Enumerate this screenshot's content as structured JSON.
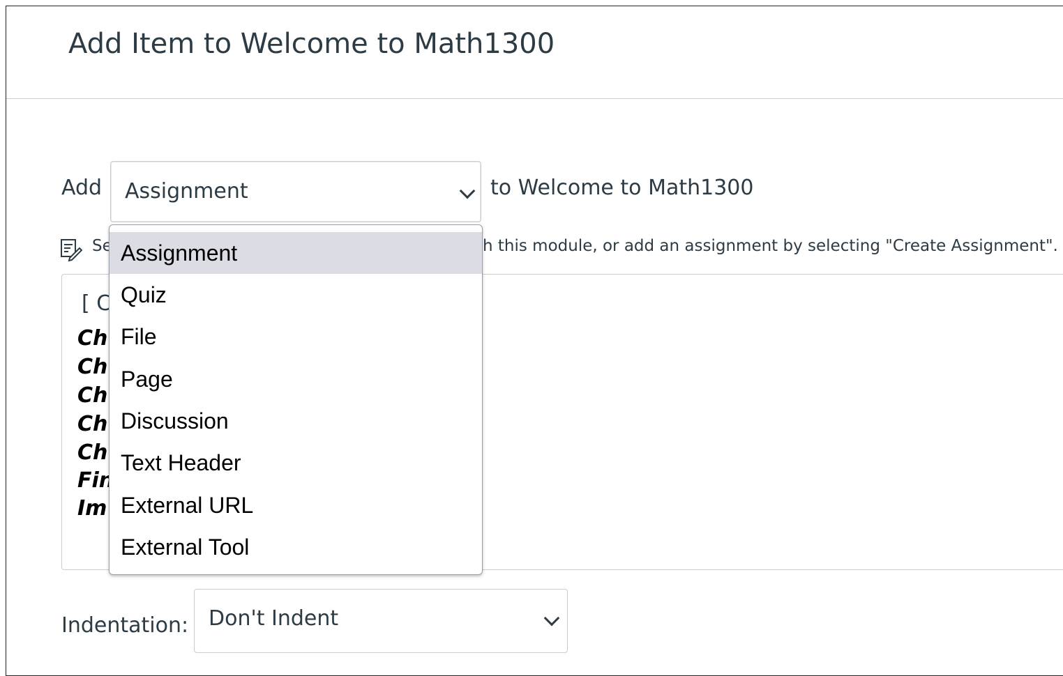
{
  "dialog": {
    "title": "Add Item to Welcome to Math1300"
  },
  "add_row": {
    "prefix": "Add",
    "selected_type": "Assignment",
    "suffix": "to Welcome to Math1300"
  },
  "hint": {
    "icon": "edit-assignment-icon",
    "text_start": "Se",
    "text_end": "h this module, or add an assignment by selecting \"Create Assignment\"."
  },
  "list_box": {
    "placeholder_visible": "[ C",
    "options_visible": [
      "Ch",
      "Ch",
      "Ch",
      "Ch",
      "Ch",
      "Fin",
      "Im"
    ]
  },
  "dropdown": {
    "options": [
      "Assignment",
      "Quiz",
      "File",
      "Page",
      "Discussion",
      "Text Header",
      "External URL",
      "External Tool"
    ],
    "selected_index": 0,
    "highlight_color": "#dcdce4"
  },
  "indentation": {
    "label": "Indentation:",
    "value": "Don't Indent"
  }
}
